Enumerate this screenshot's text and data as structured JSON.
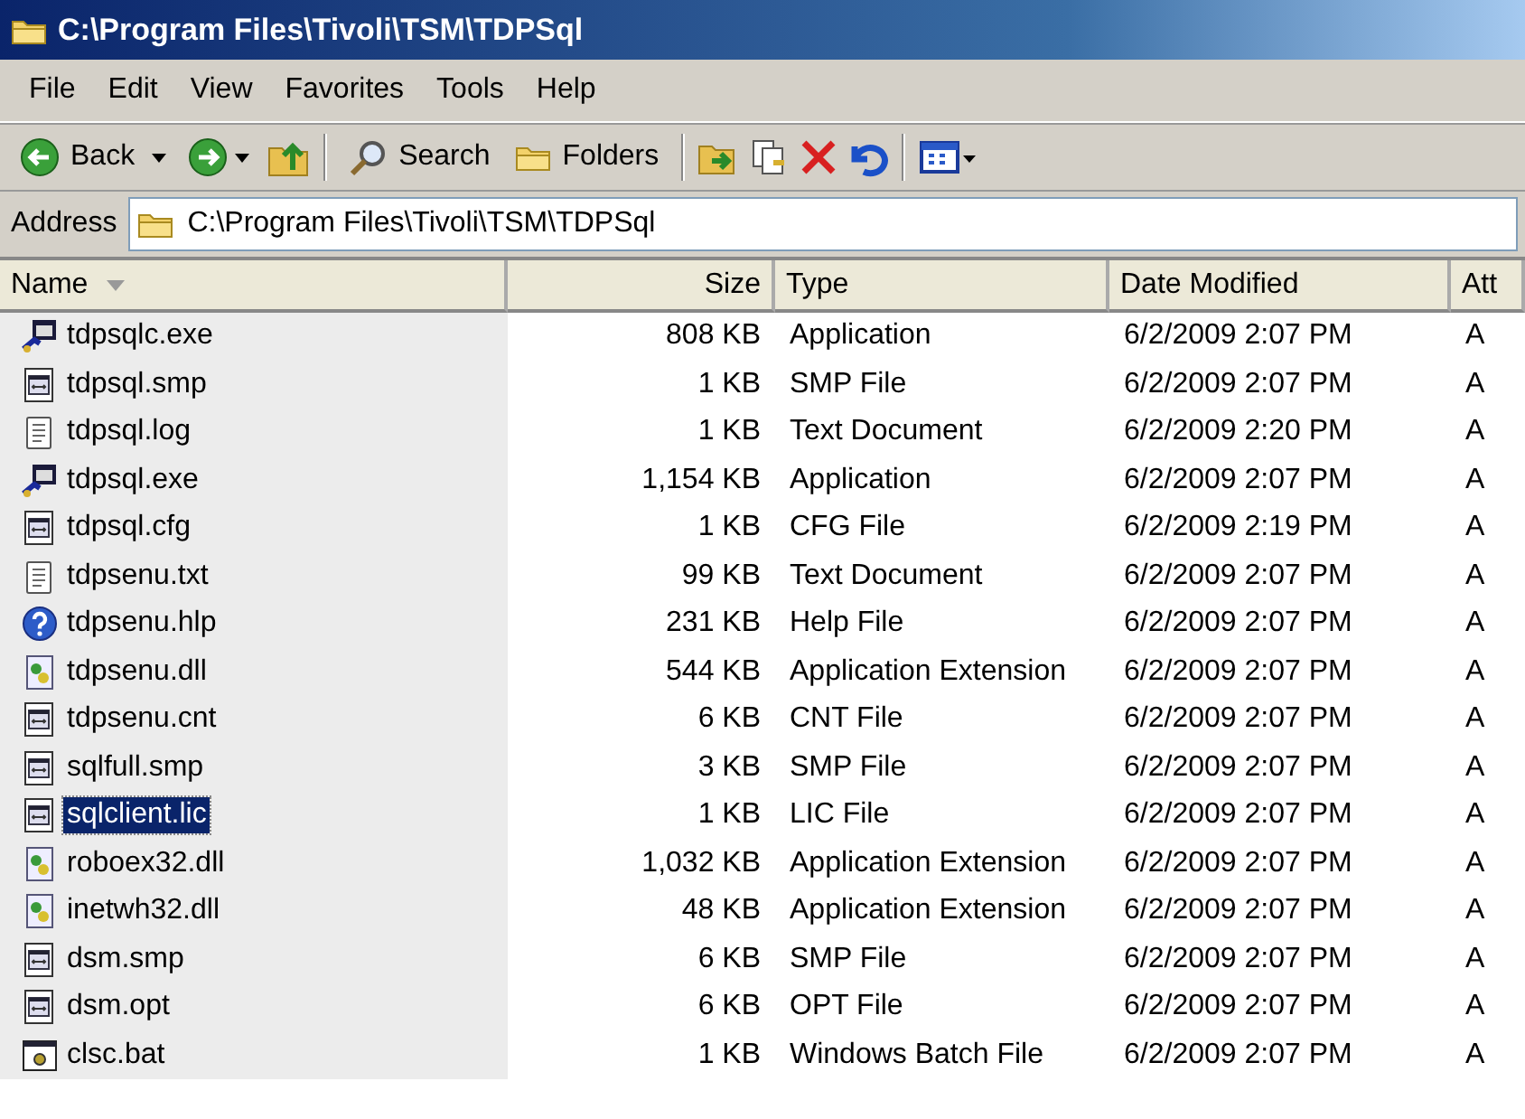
{
  "window": {
    "title": "C:\\Program Files\\Tivoli\\TSM\\TDPSql"
  },
  "menu": [
    "File",
    "Edit",
    "View",
    "Favorites",
    "Tools",
    "Help"
  ],
  "toolbar": {
    "back": "Back",
    "search": "Search",
    "folders": "Folders"
  },
  "address": {
    "label": "Address",
    "value": "C:\\Program Files\\Tivoli\\TSM\\TDPSql"
  },
  "table": {
    "columns": [
      "Name",
      "Size",
      "Type",
      "Date Modified",
      "Att"
    ],
    "rows": [
      {
        "kind": "exe",
        "name": "tdpsqlc.exe",
        "size": "808 KB",
        "type": "Application",
        "date": "6/2/2009 2:07 PM",
        "attr": "A",
        "selected": false
      },
      {
        "kind": "config",
        "name": "tdpsql.smp",
        "size": "1 KB",
        "type": "SMP File",
        "date": "6/2/2009 2:07 PM",
        "attr": "A",
        "selected": false
      },
      {
        "kind": "text",
        "name": "tdpsql.log",
        "size": "1 KB",
        "type": "Text Document",
        "date": "6/2/2009 2:20 PM",
        "attr": "A",
        "selected": false
      },
      {
        "kind": "exe",
        "name": "tdpsql.exe",
        "size": "1,154 KB",
        "type": "Application",
        "date": "6/2/2009 2:07 PM",
        "attr": "A",
        "selected": false
      },
      {
        "kind": "config",
        "name": "tdpsql.cfg",
        "size": "1 KB",
        "type": "CFG File",
        "date": "6/2/2009 2:19 PM",
        "attr": "A",
        "selected": false
      },
      {
        "kind": "text",
        "name": "tdpsenu.txt",
        "size": "99 KB",
        "type": "Text Document",
        "date": "6/2/2009 2:07 PM",
        "attr": "A",
        "selected": false
      },
      {
        "kind": "help",
        "name": "tdpsenu.hlp",
        "size": "231 KB",
        "type": "Help File",
        "date": "6/2/2009 2:07 PM",
        "attr": "A",
        "selected": false
      },
      {
        "kind": "dll",
        "name": "tdpsenu.dll",
        "size": "544 KB",
        "type": "Application Extension",
        "date": "6/2/2009 2:07 PM",
        "attr": "A",
        "selected": false
      },
      {
        "kind": "config",
        "name": "tdpsenu.cnt",
        "size": "6 KB",
        "type": "CNT File",
        "date": "6/2/2009 2:07 PM",
        "attr": "A",
        "selected": false
      },
      {
        "kind": "config",
        "name": "sqlfull.smp",
        "size": "3 KB",
        "type": "SMP File",
        "date": "6/2/2009 2:07 PM",
        "attr": "A",
        "selected": false
      },
      {
        "kind": "config",
        "name": "sqlclient.lic",
        "size": "1 KB",
        "type": "LIC File",
        "date": "6/2/2009 2:07 PM",
        "attr": "A",
        "selected": true
      },
      {
        "kind": "dll",
        "name": "roboex32.dll",
        "size": "1,032 KB",
        "type": "Application Extension",
        "date": "6/2/2009 2:07 PM",
        "attr": "A",
        "selected": false
      },
      {
        "kind": "dll",
        "name": "inetwh32.dll",
        "size": "48 KB",
        "type": "Application Extension",
        "date": "6/2/2009 2:07 PM",
        "attr": "A",
        "selected": false
      },
      {
        "kind": "config",
        "name": "dsm.smp",
        "size": "6 KB",
        "type": "SMP File",
        "date": "6/2/2009 2:07 PM",
        "attr": "A",
        "selected": false
      },
      {
        "kind": "config",
        "name": "dsm.opt",
        "size": "6 KB",
        "type": "OPT File",
        "date": "6/2/2009 2:07 PM",
        "attr": "A",
        "selected": false
      },
      {
        "kind": "batch",
        "name": "clsc.bat",
        "size": "1 KB",
        "type": "Windows Batch File",
        "date": "6/2/2009 2:07 PM",
        "attr": "A",
        "selected": false
      }
    ]
  }
}
